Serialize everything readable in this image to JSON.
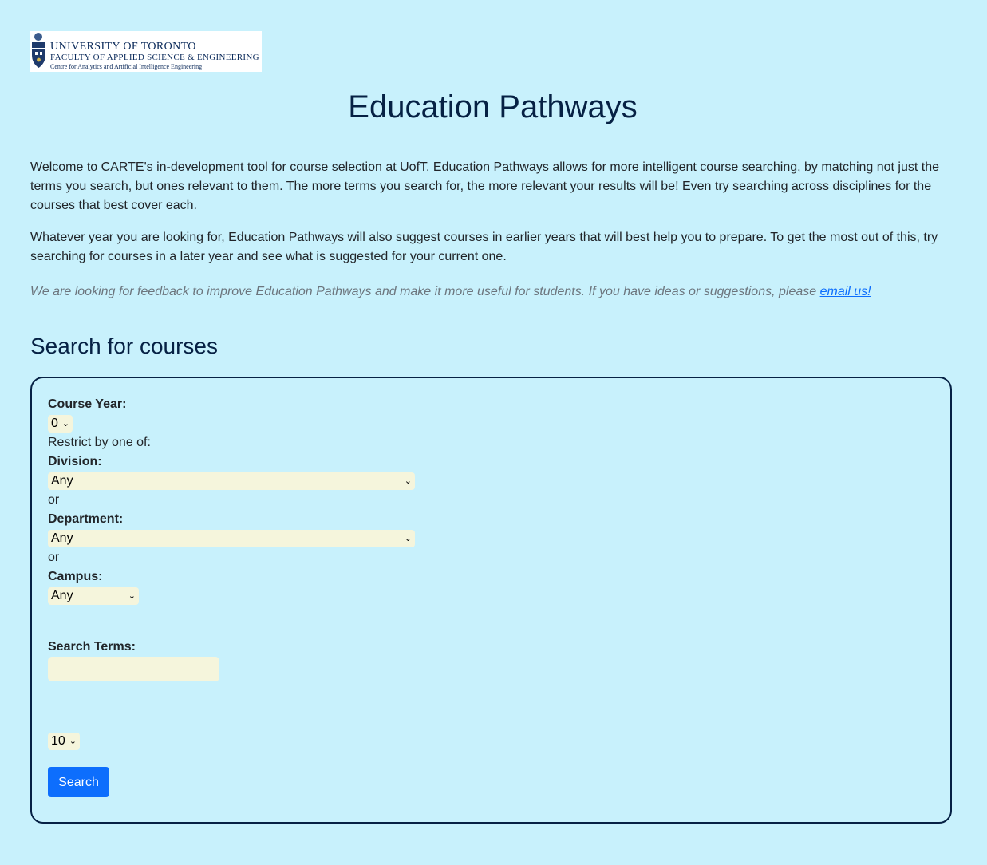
{
  "logo": {
    "line1": "UNIVERSITY OF TORONTO",
    "line2": "FACULTY OF APPLIED SCIENCE & ENGINEERING",
    "line3": "Centre for Analytics and Artificial Intelligence Engineering"
  },
  "header": {
    "title": "Education Pathways"
  },
  "intro": {
    "p1": "Welcome to CARTE's in-development tool for course selection at UofT. Education Pathways allows for more intelligent course searching, by matching not just the terms you search, but ones relevant to them. The more terms you search for, the more relevant your results will be! Even try searching across disciplines for the courses that best cover each.",
    "p2": "Whatever year you are looking for, Education Pathways will also suggest courses in earlier years that will best help you to prepare. To get the most out of this, try searching for courses in a later year and see what is suggested for your current one.",
    "feedback_text": "We are looking for feedback to improve Education Pathways and make it more useful for students. If you have ideas or suggestions, please ",
    "feedback_link": "email us!"
  },
  "search": {
    "heading": "Search for courses",
    "course_year_label": "Course Year:",
    "course_year_value": "0",
    "restrict_text": "Restrict by one of:",
    "division_label": "Division:",
    "division_value": "Any",
    "or1": "or",
    "department_label": "Department:",
    "department_value": "Any",
    "or2": "or",
    "campus_label": "Campus:",
    "campus_value": "Any",
    "terms_label": "Search Terms:",
    "terms_value": "",
    "results_count_value": "10",
    "search_button": "Search"
  }
}
